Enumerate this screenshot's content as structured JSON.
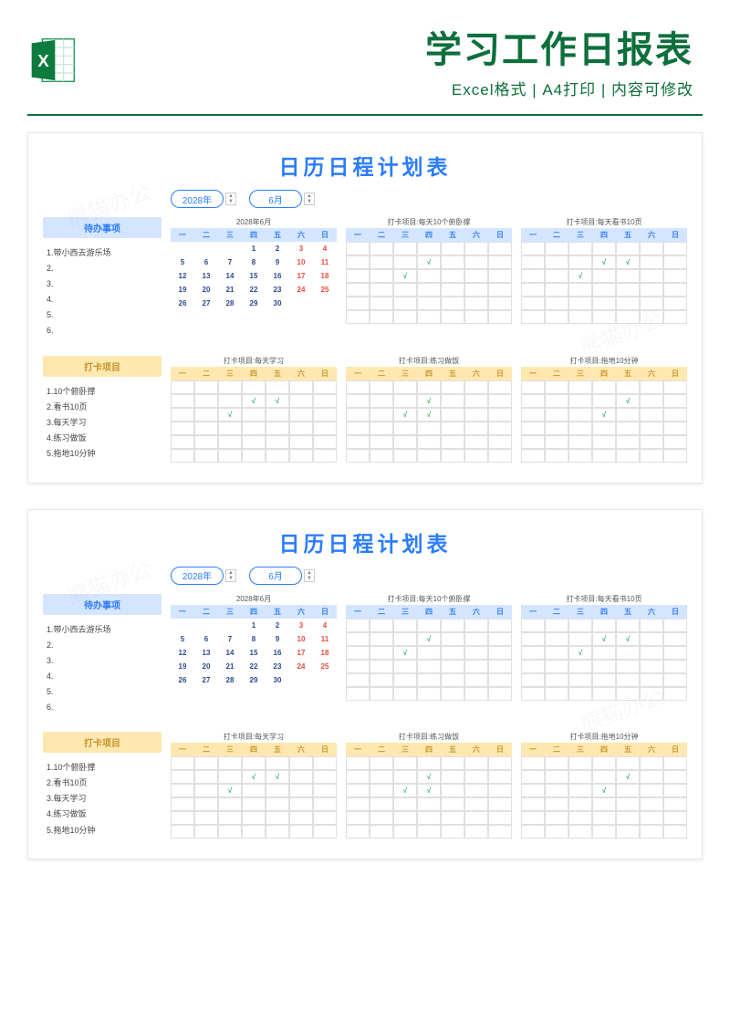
{
  "header": {
    "title": "学习工作日报表",
    "subtitle": "Excel格式 | A4打印 | 内容可修改"
  },
  "page": {
    "title": "日历日程计划表",
    "year_label": "2028年",
    "month_label": "6月",
    "calendar_label": "2028年6月",
    "todo_header": "待办事项",
    "checkin_header": "打卡项目",
    "dow": [
      "一",
      "二",
      "三",
      "四",
      "五",
      "六",
      "日"
    ],
    "todo_items": [
      "1.带小西去游乐场",
      "2.",
      "3.",
      "4.",
      "5.",
      "6."
    ],
    "checkin_items": [
      "1.10个俯卧撑",
      "2.看书10页",
      "3.每天学习",
      "4.练习做饭",
      "5.拖地10分钟"
    ],
    "tracker_titles": {
      "t1": "打卡项目:每天10个俯卧撑",
      "t2": "打卡项目:每天看书10页",
      "t3": "打卡项目:每天学习",
      "t4": "打卡项目:练习做饭",
      "t5": "打卡项目:拖地10分钟"
    },
    "calendar_days": [
      [
        "",
        "",
        "",
        "1",
        "2",
        "3",
        "4"
      ],
      [
        "5",
        "6",
        "7",
        "8",
        "9",
        "10",
        "11"
      ],
      [
        "12",
        "13",
        "14",
        "15",
        "16",
        "17",
        "18"
      ],
      [
        "19",
        "20",
        "21",
        "22",
        "23",
        "24",
        "25"
      ],
      [
        "26",
        "27",
        "28",
        "29",
        "30",
        "",
        ""
      ],
      [
        "",
        "",
        "",
        "",
        "",
        "",
        ""
      ]
    ],
    "tick": "√"
  },
  "watermark": "熊猫办公"
}
